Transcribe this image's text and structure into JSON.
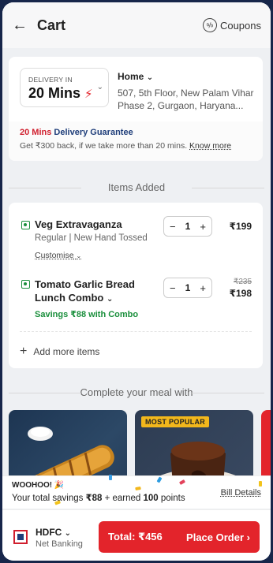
{
  "header": {
    "title": "Cart",
    "coupons_label": "Coupons",
    "coupon_icon_text": "%"
  },
  "delivery": {
    "label": "DELIVERY IN",
    "eta": "20 Mins",
    "address_title": "Home",
    "address": "507, 5th Floor, New Palam Vihar Phase 2, Gurgaon, Haryana..."
  },
  "guarantee": {
    "time": "20 Mins",
    "title": "Delivery Guarantee",
    "text": "Get ₹300 back, if we take more than 20 mins.",
    "link": "Know more"
  },
  "items_section_title": "Items Added",
  "items": [
    {
      "name": "Veg Extravaganza",
      "variant": "Regular | New Hand Tossed",
      "customise": "Customise",
      "qty": "1",
      "price": "₹199"
    },
    {
      "name": "Tomato Garlic Bread Lunch Combo",
      "savings": "Savings ₹88 with Combo",
      "qty": "1",
      "old_price": "₹235",
      "price": "₹198"
    }
  ],
  "add_more_label": "Add more items",
  "meal_section_title": "Complete your meal with",
  "meal_badge": "MOST POPULAR",
  "savings_strip": {
    "woohoo": "WOOHOO!",
    "prefix": "Your total savings",
    "amount": "₹88",
    "middle": "+ earned",
    "points": "100",
    "suffix": "points",
    "bill_details": "Bill Details"
  },
  "payment": {
    "bank": "HDFC",
    "method": "Net Banking"
  },
  "order": {
    "total": "Total: ₹456",
    "cta": "Place Order"
  },
  "colors": {
    "accent": "#e3242b",
    "brand_blue": "#1f3e7a",
    "veg_green": "#1a8f3c"
  }
}
